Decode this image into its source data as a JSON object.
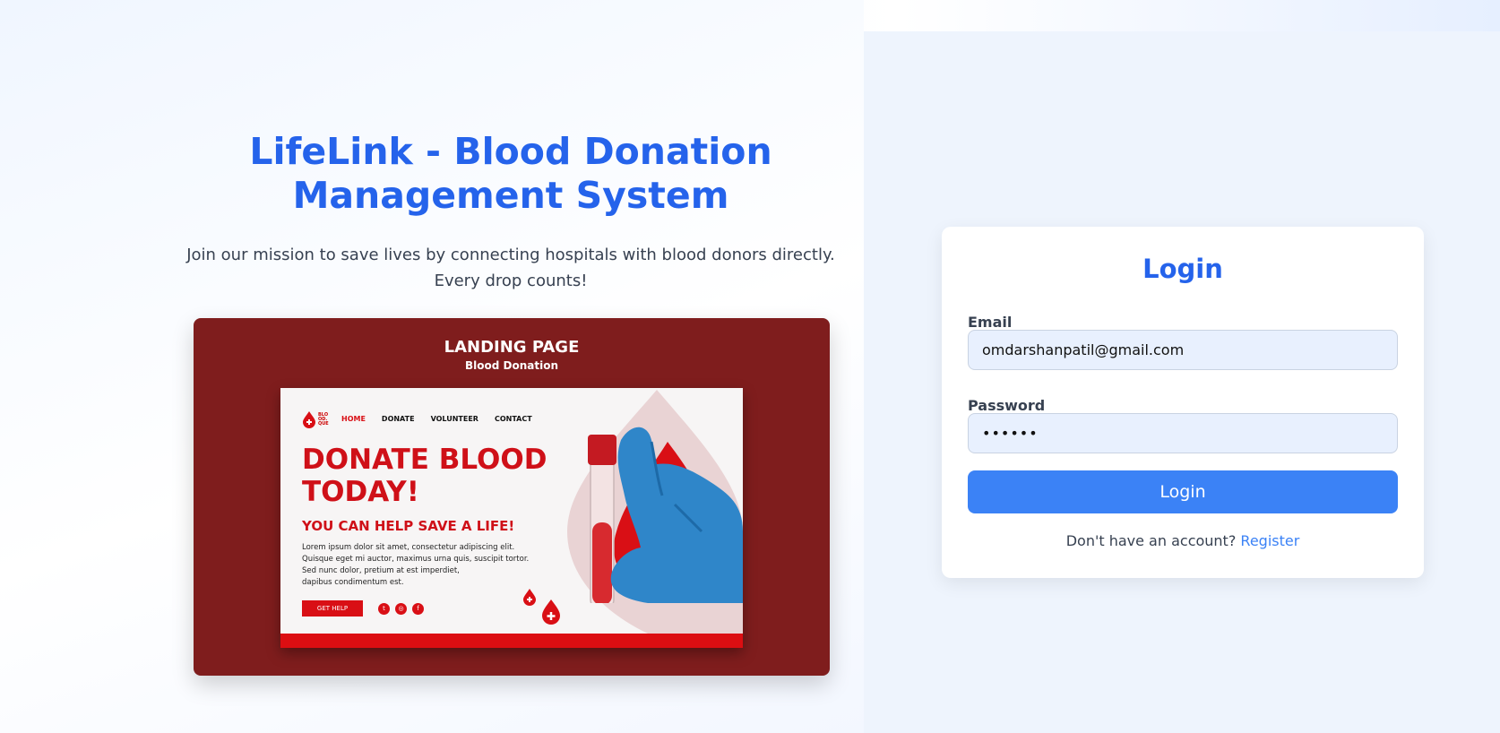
{
  "hero": {
    "title_line1": "LifeLink - Blood Donation",
    "title_line2": "Management System",
    "subtitle_line1": "Join our mission to save lives by connecting hospitals with blood donors directly.",
    "subtitle_line2": "Every drop counts!"
  },
  "banner": {
    "title": "LANDING PAGE",
    "subtitle": "Blood Donation",
    "mockup": {
      "logo_text": "BLO OD. QUE",
      "nav": [
        "HOME",
        "DONATE",
        "VOLUNTEER",
        "CONTACT"
      ],
      "headline_line1": "DONATE BLOOD",
      "headline_line2": "TODAY!",
      "tagline": "YOU CAN HELP SAVE A LIFE!",
      "body_lines": [
        "Lorem ipsum dolor sit amet, consectetur adipiscing elit.",
        "Quisque eget mi auctor, maximus urna quis, suscipit tortor.",
        "Sed nunc dolor, pretium at est imperdiet,",
        "dapibus condimentum est."
      ],
      "cta": "GET HELP",
      "social_icons": [
        "twitter-icon",
        "instagram-icon",
        "facebook-icon"
      ]
    },
    "colors": {
      "background": "#7f1d1d",
      "accent": "#d90f15"
    }
  },
  "login": {
    "title": "Login",
    "email_label": "Email",
    "email_value": "omdarshanpatil@gmail.com",
    "password_label": "Password",
    "password_value": "••••••",
    "submit_label": "Login",
    "register_prompt": "Don't have an account?",
    "register_link": "Register"
  },
  "colors": {
    "primary": "#2563eb",
    "button": "#3b82f6",
    "input_bg": "#e8f0fe"
  }
}
